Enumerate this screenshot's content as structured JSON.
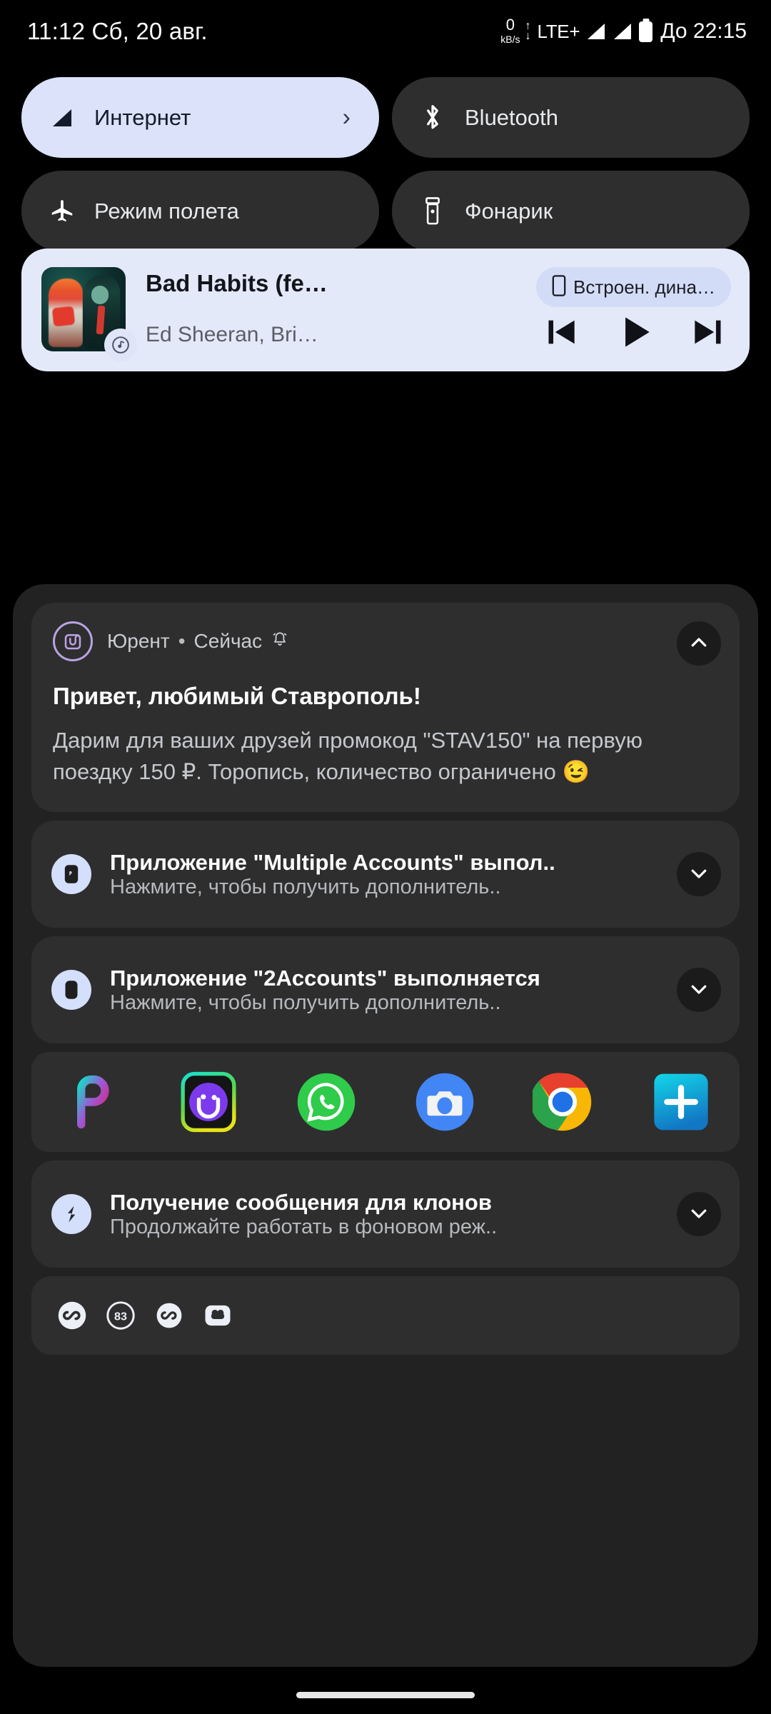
{
  "status_bar": {
    "time_date": "11:12 Сб, 20 авг.",
    "net_speed_value": "0",
    "net_speed_unit": "kB/s",
    "network_type": "LTE+",
    "battery_label": "До 22:15"
  },
  "quick_settings": {
    "tiles": [
      {
        "label": "Интернет",
        "icon": "signal-icon",
        "active": true,
        "chevron": "›"
      },
      {
        "label": "Bluetooth",
        "icon": "bluetooth-icon",
        "active": false,
        "chevron": ""
      },
      {
        "label": "Режим полета",
        "icon": "airplane-icon",
        "active": false,
        "chevron": ""
      },
      {
        "label": "Фонарик",
        "icon": "flashlight-icon",
        "active": false,
        "chevron": ""
      }
    ]
  },
  "media_player": {
    "title": "Bad Habits (fe…",
    "artist": "Ed Sheeran, Bri…",
    "output_chip_label": "Встроен. дина…",
    "output_chip_icon": "phone-speaker-icon",
    "app_badge_icon": "music-app-icon",
    "controls": {
      "previous": "previous-track",
      "play": "play",
      "next": "next-track"
    }
  },
  "notifications": [
    {
      "type": "expanded",
      "app_name": "Юрент",
      "time": "Сейчас",
      "separator": "•",
      "alert_icon": "bell-ringing-icon",
      "app_icon": "yurent-icon",
      "title": "Привет, любимый Ставрополь!",
      "body": "Дарим для ваших друзей промокод \"STAV150\" на первую поездку 150 ₽. Торопись, количество ограничено 😉",
      "expand_icon": "chevron-up-icon"
    },
    {
      "type": "compact",
      "app_icon": "multiple-accounts-icon",
      "title": "Приложение \"Multiple Accounts\" выпол..",
      "subtitle": "Нажмите, чтобы получить дополнитель..",
      "expand_icon": "chevron-down-icon"
    },
    {
      "type": "compact",
      "app_icon": "two-accounts-icon",
      "title": "Приложение \"2Accounts\" выполняется",
      "subtitle": "Нажмите, чтобы получить дополнитель..",
      "expand_icon": "chevron-down-icon"
    }
  ],
  "app_shortcuts": [
    {
      "name": "picsart-icon"
    },
    {
      "name": "clone-app-icon"
    },
    {
      "name": "whatsapp-icon"
    },
    {
      "name": "camera-icon"
    },
    {
      "name": "chrome-icon"
    },
    {
      "name": "add-clone-icon"
    }
  ],
  "notification_last": {
    "type": "compact",
    "app_icon": "clone-message-icon",
    "title": "Получение сообщения для клонов",
    "subtitle": "Продолжайте работать в фоновом реж..",
    "expand_icon": "chevron-down-icon"
  },
  "footer_icons": [
    {
      "name": "infinity-circle-icon",
      "label": ""
    },
    {
      "name": "battery-percent-icon",
      "label": "83"
    },
    {
      "name": "infinity-circle-icon-2",
      "label": ""
    },
    {
      "name": "dual-blob-icon",
      "label": ""
    }
  ],
  "colors": {
    "accent_light": "#dbe2f9",
    "media_bg": "#e4e9fa",
    "tile_bg": "#2e2e2e",
    "panel_bg": "#222222",
    "notif_bg": "#2e2e2e",
    "background": "#000000"
  }
}
